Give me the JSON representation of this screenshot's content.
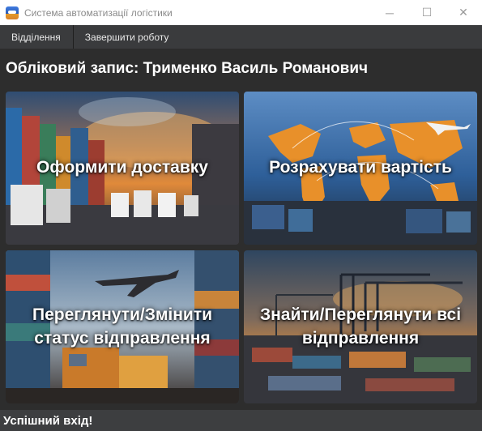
{
  "window": {
    "title": "Система автоматизації логістики",
    "minimize_icon": "─",
    "maximize_icon": "☐",
    "close_icon": "✕"
  },
  "menu": {
    "items": [
      {
        "label": "Відділення"
      },
      {
        "label": "Завершити роботу"
      }
    ]
  },
  "account": {
    "label": "Обліковий запис: Трименко Василь Романович"
  },
  "tiles": [
    {
      "label": "Оформити доставку",
      "image": "trucks-containers-sunset"
    },
    {
      "label": "Розрахувати вартість",
      "image": "world-map-airplane-containers"
    },
    {
      "label": "Переглянути/Змінити статус відправлення",
      "image": "cargo-plane-truck-containers"
    },
    {
      "label": "Знайти/Переглянути всі відправлення",
      "image": "port-cranes-containers"
    }
  ],
  "status": {
    "text": "Успішний вхід!"
  },
  "colors": {
    "menubar": "#3a3b3d",
    "content_bg": "#2d2d2d",
    "statusbar": "#3d3e40"
  }
}
